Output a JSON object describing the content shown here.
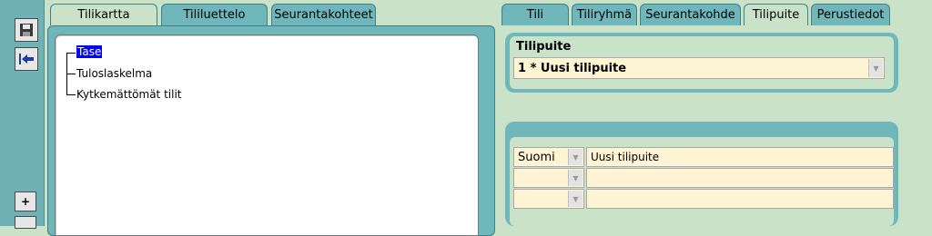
{
  "left_tabs": [
    "Tilikartta",
    "Tililuettelo",
    "Seurantakohteet"
  ],
  "right_tabs": [
    "Tili",
    "Tiliryhmä",
    "Seurantakohde",
    "Tilipuite",
    "Perustiedot"
  ],
  "tree": {
    "items": [
      "Tase",
      "Tuloslaskelma",
      "Kytkemättömät tilit"
    ],
    "selected": "Tase"
  },
  "tilipuite": {
    "label": "Tilipuite",
    "selected_value": "1 * Uusi tilipuite"
  },
  "translations": {
    "rows": [
      {
        "language": "Suomi",
        "text": "Uusi tilipuite"
      },
      {
        "language": "",
        "text": ""
      },
      {
        "language": "",
        "text": ""
      }
    ]
  },
  "toolbar": {
    "save_icon": "floppy-disk-icon",
    "exit_icon": "exit-arrow-icon",
    "plus_label": "+"
  },
  "colors": {
    "teal": "#6fb7bb",
    "panel_bg": "#c9e2c8",
    "selection": "#0000ff",
    "field_bg": "#fff4d4"
  }
}
